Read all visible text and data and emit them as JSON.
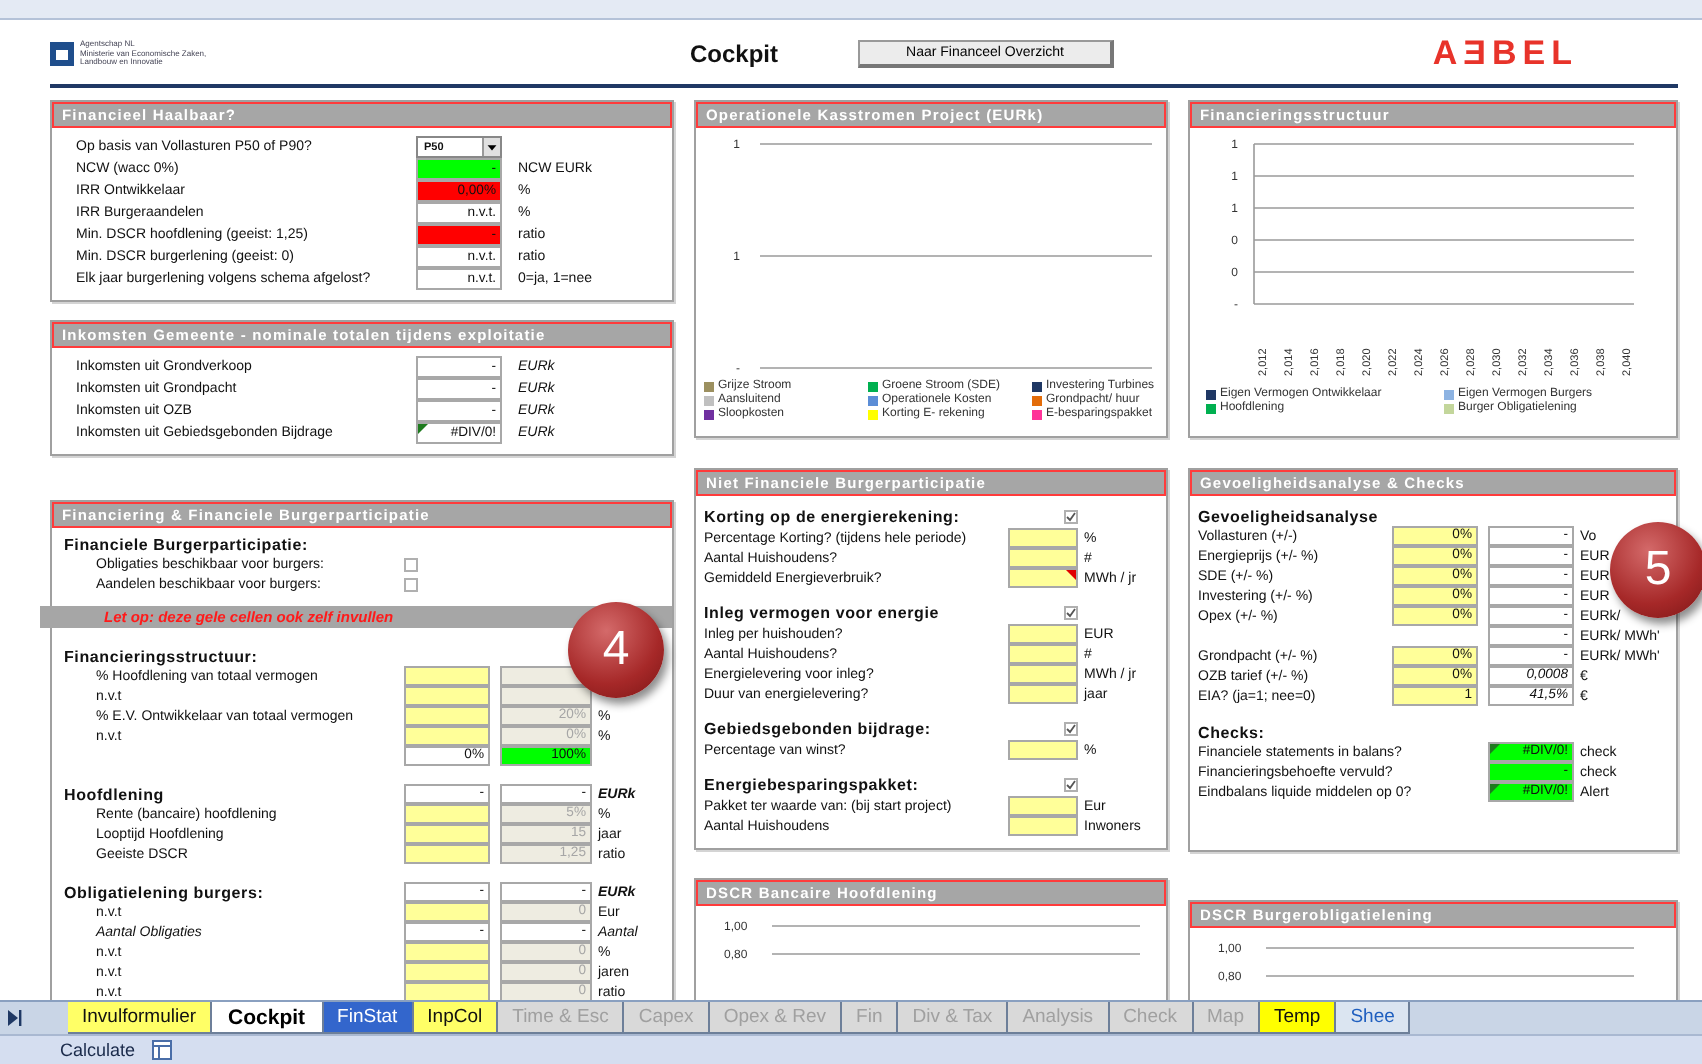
{
  "sheet_header": {
    "logo_lines": [
      "Agentschap NL",
      "Ministerie van Economische Zaken,",
      "Landbouw en Innovatie"
    ],
    "title": "Cockpit",
    "button": "Naar Financeel Overzicht",
    "brand": "AƎBEL"
  },
  "haalbaar": {
    "title": "Financieel Haalbaar?",
    "rows": [
      {
        "kind": "field",
        "label": "Op basis van Vollasturen P50 of P90?",
        "cells": [
          {
            "value": "P50",
            "dropdown": true
          }
        ]
      },
      {
        "kind": "field",
        "label": "NCW  (wacc 0%)",
        "cells": [
          {
            "value": "-",
            "color": "#00ff00"
          }
        ],
        "unit": "NCW EURk"
      },
      {
        "kind": "field",
        "label": "IRR Ontwikkelaar",
        "cells": [
          {
            "value": "0,00%",
            "color": "#ff0000"
          }
        ],
        "unit": "%"
      },
      {
        "kind": "field",
        "label": "IRR Burgeraandelen",
        "cells": [
          {
            "value": "n.v.t.",
            "color": "#ffffff"
          }
        ],
        "unit": "%"
      },
      {
        "kind": "field",
        "label": "Min. DSCR hoofdlening  (geeist:  1,25)",
        "cells": [
          {
            "value": "-",
            "color": "#ff0000"
          }
        ],
        "unit": "ratio"
      },
      {
        "kind": "field",
        "label": "Min. DSCR burgerlening  (geeist:  0)",
        "cells": [
          {
            "value": "n.v.t.",
            "color": "#ffffff"
          }
        ],
        "unit": "ratio"
      },
      {
        "kind": "field",
        "label": "Elk jaar burgerlening volgens schema afgelost?",
        "cells": [
          {
            "value": "n.v.t.",
            "color": "#ffffff"
          }
        ],
        "unit": "0=ja, 1=nee"
      }
    ]
  },
  "inkomsten": {
    "title": "Inkomsten Gemeente - nominale totalen tijdens exploitatie",
    "rows": [
      {
        "kind": "field",
        "label": "Inkomsten uit Grondverkoop",
        "cells": [
          {
            "value": "-",
            "color": "#ffffff"
          }
        ],
        "unit": "EURk"
      },
      {
        "kind": "field",
        "label": "Inkomsten uit Grondpacht",
        "cells": [
          {
            "value": "-",
            "color": "#ffffff"
          }
        ],
        "unit": "EURk"
      },
      {
        "kind": "field",
        "label": "Inkomsten uit OZB",
        "cells": [
          {
            "value": "-",
            "color": "#ffffff"
          }
        ],
        "unit": "EURk"
      },
      {
        "kind": "field",
        "label": "Inkomsten uit Gebiedsgebonden Bijdrage",
        "cells": [
          {
            "value": "#DIV/0!",
            "color": "#ffffff",
            "error_flag": true
          }
        ],
        "unit": "EURk"
      }
    ]
  },
  "financiering": {
    "title": "Financiering & Financiele Burgerparticipatie",
    "badge": "4",
    "rows": [
      {
        "kind": "heading",
        "label": "Financiele Burgerparticipatie:"
      },
      {
        "kind": "check",
        "label": "Obligaties beschikbaar voor burgers:",
        "checked": false
      },
      {
        "kind": "check",
        "label": "Aandelen beschikbaar voor burgers:",
        "checked": false
      },
      {
        "kind": "notice",
        "label": "Let op: deze gele cellen ook zelf invullen"
      },
      {
        "kind": "heading",
        "label": "Financieringsstructuur:"
      },
      {
        "kind": "field",
        "label": "% Hoofdlening van totaal vermogen",
        "cells": [
          {
            "color": "#ffff99"
          },
          {
            "color": "#eeece1"
          }
        ]
      },
      {
        "kind": "field",
        "label": "n.v.t",
        "cells": [
          {
            "color": "#ffff99"
          },
          {
            "color": "#eeece1"
          }
        ]
      },
      {
        "kind": "field",
        "label": "% E.V. Ontwikkelaar van totaal vermogen",
        "cells": [
          {
            "color": "#ffff99"
          },
          {
            "value": "20%",
            "color": "#eeece1"
          }
        ],
        "unit": "%"
      },
      {
        "kind": "field",
        "label": "n.v.t",
        "cells": [
          {
            "color": "#ffff99"
          },
          {
            "value": "0%",
            "color": "#eeece1"
          }
        ],
        "unit": "%"
      },
      {
        "kind": "field",
        "cells": [
          {
            "value": "0%",
            "color": "#ffffff"
          },
          {
            "value": "100%",
            "color": "#00ff00"
          }
        ]
      },
      {
        "kind": "heading",
        "label": "Hoofdlening",
        "cells": [
          {
            "value": "-",
            "color": "#ffffff"
          },
          {
            "value": "-",
            "color": "#ffffff"
          }
        ],
        "unit": "EURk"
      },
      {
        "kind": "field",
        "label": "Rente (bancaire) hoofdlening",
        "cells": [
          {
            "color": "#ffff99"
          },
          {
            "value": "5%",
            "color": "#eeece1"
          }
        ],
        "unit": "%"
      },
      {
        "kind": "field",
        "label": "Looptijd Hoofdlening",
        "cells": [
          {
            "color": "#ffff99"
          },
          {
            "value": "15",
            "color": "#eeece1"
          }
        ],
        "unit": "jaar"
      },
      {
        "kind": "field",
        "label": "Geeiste DSCR",
        "cells": [
          {
            "color": "#ffff99"
          },
          {
            "value": "1,25",
            "color": "#eeece1"
          }
        ],
        "unit": "ratio"
      },
      {
        "kind": "heading",
        "label": "Obligatielening burgers:",
        "cells": [
          {
            "value": "-",
            "color": "#ffffff"
          },
          {
            "value": "-",
            "color": "#ffffff"
          }
        ],
        "unit": "EURk"
      },
      {
        "kind": "field",
        "label": "n.v.t",
        "cells": [
          {
            "color": "#ffff99"
          },
          {
            "value": "0",
            "color": "#eeece1"
          }
        ],
        "unit": "Eur"
      },
      {
        "kind": "count",
        "label": "Aantal Obligaties",
        "cells": [
          {
            "value": "-",
            "color": "#ffffff"
          },
          {
            "value": "-",
            "color": "#ffffff"
          }
        ],
        "unit": "Aantal"
      },
      {
        "kind": "field",
        "label": "n.v.t",
        "cells": [
          {
            "color": "#ffff99"
          },
          {
            "value": "0",
            "color": "#eeece1"
          }
        ],
        "unit": "%"
      },
      {
        "kind": "field",
        "label": "n.v.t",
        "cells": [
          {
            "color": "#ffff99"
          },
          {
            "value": "0",
            "color": "#eeece1"
          }
        ],
        "unit": "jaren"
      },
      {
        "kind": "field",
        "label": "n.v.t",
        "cells": [
          {
            "color": "#ffff99"
          },
          {
            "value": "0",
            "color": "#eeece1"
          }
        ],
        "unit": "ratio"
      }
    ]
  },
  "kasstromen": {
    "title": "Operationele Kasstromen Project (EURk)",
    "y_labels": [
      "1",
      "1",
      "-"
    ],
    "legend": [
      {
        "label": "Grijze Stroom",
        "color": "#9c9060"
      },
      {
        "label": "Groene Stroom (SDE)",
        "color": "#00b050"
      },
      {
        "label": "Investering Turbines",
        "color": "#1f3864"
      },
      {
        "label": "Aansluitend",
        "color": "#c0c0c0"
      },
      {
        "label": "Operationele Kosten",
        "color": "#5b8dd6"
      },
      {
        "label": "Grondpacht/ huur",
        "color": "#e36c09"
      },
      {
        "label": "Sloopkosten",
        "color": "#7030a0"
      },
      {
        "label": "Korting E- rekening",
        "color": "#ffff00"
      },
      {
        "label": "E-besparingspakket",
        "color": "#ff3399"
      }
    ]
  },
  "structuur": {
    "title": "Financieringsstructuur",
    "y_labels": [
      "1",
      "1",
      "1",
      "0",
      "0",
      "-"
    ],
    "x_labels": [
      "2,012",
      "2,014",
      "2,016",
      "2,018",
      "2,020",
      "2,022",
      "2,024",
      "2,026",
      "2,028",
      "2,030",
      "2,032",
      "2,034",
      "2,036",
      "2,038",
      "2,040"
    ],
    "legend": [
      {
        "label": "Eigen Vermogen Ontwikkelaar",
        "color": "#1f3864"
      },
      {
        "label": "Eigen Vermogen Burgers",
        "color": "#8db3e2"
      },
      {
        "label": "Hoofdlening",
        "color": "#00b050"
      },
      {
        "label": "Burger Obligatielening",
        "color": "#c3d69b"
      }
    ]
  },
  "niet_financieel": {
    "title": "Niet Financiele Burgerparticipatie",
    "rows": [
      {
        "kind": "section",
        "label": "Korting op de energierekening:",
        "checked": true
      },
      {
        "kind": "field",
        "label": "Percentage Korting? (tijdens hele periode)",
        "cells": [
          {
            "color": "#ffff99"
          }
        ],
        "unit": "%"
      },
      {
        "kind": "field",
        "label": "Aantal Huishoudens?",
        "cells": [
          {
            "color": "#ffff99"
          }
        ],
        "unit": "#"
      },
      {
        "kind": "field",
        "label": "Gemiddeld Energieverbruik?",
        "cells": [
          {
            "color": "#ffff99",
            "comment": true
          }
        ],
        "unit": "MWh / jr"
      },
      {
        "kind": "section",
        "label": "Inleg vermogen voor energie",
        "checked": true
      },
      {
        "kind": "field",
        "label": "Inleg per huishouden?",
        "cells": [
          {
            "color": "#ffff99"
          }
        ],
        "unit": "EUR"
      },
      {
        "kind": "field",
        "label": "Aantal Huishoudens?",
        "cells": [
          {
            "color": "#ffff99"
          }
        ],
        "unit": "#"
      },
      {
        "kind": "field",
        "label": "Energielevering voor  inleg?",
        "cells": [
          {
            "color": "#ffff99"
          }
        ],
        "unit": "MWh / jr"
      },
      {
        "kind": "field",
        "label": "Duur van energielevering?",
        "cells": [
          {
            "color": "#ffff99"
          }
        ],
        "unit": "jaar"
      },
      {
        "kind": "section",
        "label": "Gebiedsgebonden bijdrage:",
        "checked": true
      },
      {
        "kind": "field",
        "label": "Percentage van winst?",
        "cells": [
          {
            "color": "#ffff99"
          }
        ],
        "unit": "%"
      },
      {
        "kind": "section",
        "label": "Energiebesparingspakket:",
        "checked": true
      },
      {
        "kind": "field",
        "label": "Pakket ter waarde van:  (bij start project)",
        "cells": [
          {
            "color": "#ffff99"
          }
        ],
        "unit": "Eur"
      },
      {
        "kind": "field",
        "label": "Aantal Huishoudens",
        "cells": [
          {
            "color": "#ffff99"
          }
        ],
        "unit": "Inwoners"
      }
    ]
  },
  "gevoeligheid": {
    "title": "Gevoeligheidsanalyse & Checks",
    "badge": "5",
    "rows": [
      {
        "kind": "heading",
        "label": "Gevoeligheidsanalyse"
      },
      {
        "kind": "field",
        "label": "Vollasturen (+/-)",
        "cells": [
          {
            "value": "0%",
            "color": "#ffff99"
          },
          {
            "value": "-",
            "color": "#ffffff"
          }
        ],
        "unit": "Vo"
      },
      {
        "kind": "field",
        "label": "Energieprijs (+/- %)",
        "cells": [
          {
            "value": "0%",
            "color": "#ffff99"
          },
          {
            "value": "-",
            "color": "#ffffff"
          }
        ],
        "unit": "EUR"
      },
      {
        "kind": "field",
        "label": "SDE (+/- %)",
        "cells": [
          {
            "value": "0%",
            "color": "#ffff99"
          },
          {
            "value": "-",
            "color": "#ffffff"
          }
        ],
        "unit": "EUR"
      },
      {
        "kind": "field",
        "label": "Investering (+/- %)",
        "cells": [
          {
            "value": "0%",
            "color": "#ffff99"
          },
          {
            "value": "-",
            "color": "#ffffff"
          }
        ],
        "unit": "EUR"
      },
      {
        "kind": "field",
        "label": "Opex (+/- %)",
        "cells": [
          {
            "value": "0%",
            "color": "#ffff99"
          },
          {
            "value": "-",
            "color": "#ffffff"
          }
        ],
        "unit": "EURk/"
      },
      {
        "kind": "result",
        "cells": [
          {
            "value": "-",
            "color": "#ffffff"
          }
        ],
        "unit": "EURk/ MWh'"
      },
      {
        "kind": "field",
        "label": "Grondpacht (+/- %)",
        "cells": [
          {
            "value": "0%",
            "color": "#ffff99"
          },
          {
            "value": "-",
            "color": "#ffffff"
          }
        ],
        "unit": "EURk/ MWh'"
      },
      {
        "kind": "rate",
        "label": "OZB tarief (+/- %)",
        "cells": [
          {
            "value": "0%",
            "color": "#ffff99"
          },
          {
            "value": "0,0008",
            "color": "#ffffff"
          }
        ],
        "unit": "€"
      },
      {
        "kind": "rate",
        "label": "EIA?  (ja=1; nee=0)",
        "cells": [
          {
            "value": "1",
            "color": "#ffff99"
          },
          {
            "value": "41,5%",
            "color": "#ffffff"
          }
        ],
        "unit": "€"
      },
      {
        "kind": "heading",
        "label": "Checks:"
      },
      {
        "kind": "result",
        "label": "Financiele statements in balans?",
        "cells": [
          {
            "value": "#DIV/0!",
            "color": "#00ff00",
            "error_flag": true
          }
        ],
        "unit": "check"
      },
      {
        "kind": "result",
        "label": "Financieringsbehoefte vervuld?",
        "cells": [
          {
            "value": "-",
            "color": "#00ff00"
          }
        ],
        "unit": "check"
      },
      {
        "kind": "result",
        "label": "Eindbalans liquide middelen op 0?",
        "cells": [
          {
            "value": "#DIV/0!",
            "color": "#00ff00",
            "error_flag": true
          }
        ],
        "unit": "Alert"
      }
    ]
  },
  "dscr_bank": {
    "title": "DSCR Bancaire Hoofdlening",
    "y_labels": [
      "1,00",
      "0,80"
    ]
  },
  "dscr_burger": {
    "title": "DSCR Burgerobligatielening",
    "y_labels": [
      "1,00",
      "0,80"
    ]
  },
  "tabs": [
    {
      "label": "Invulformulier",
      "color": "#ffff66",
      "selected": false
    },
    {
      "label": "Cockpit",
      "color": "#ffffff",
      "selected": true
    },
    {
      "label": "FinStat",
      "color": "#3366cc",
      "selected": false
    },
    {
      "label": "InpCol",
      "color": "#ffff66",
      "selected": false
    },
    {
      "label": "Time & Esc",
      "color": "#d9d9d9",
      "selected": false
    },
    {
      "label": "Capex",
      "color": "#d9d9d9",
      "selected": false
    },
    {
      "label": "Opex & Rev",
      "color": "#d9d9d9",
      "selected": false
    },
    {
      "label": "Fin",
      "color": "#d9d9d9",
      "selected": false
    },
    {
      "label": "Div & Tax",
      "color": "#d9d9d9",
      "selected": false
    },
    {
      "label": "Analysis",
      "color": "#d9d9d9",
      "selected": false
    },
    {
      "label": "Check",
      "color": "#d9d9d9",
      "selected": false
    },
    {
      "label": "Map",
      "color": "#d9d9d9",
      "selected": false
    },
    {
      "label": "Temp",
      "color": "#ffff00",
      "selected": false
    },
    {
      "label": "Shee",
      "color": "#dbe5f1",
      "selected": false
    }
  ],
  "status_bar": {
    "label": "Calculate"
  }
}
